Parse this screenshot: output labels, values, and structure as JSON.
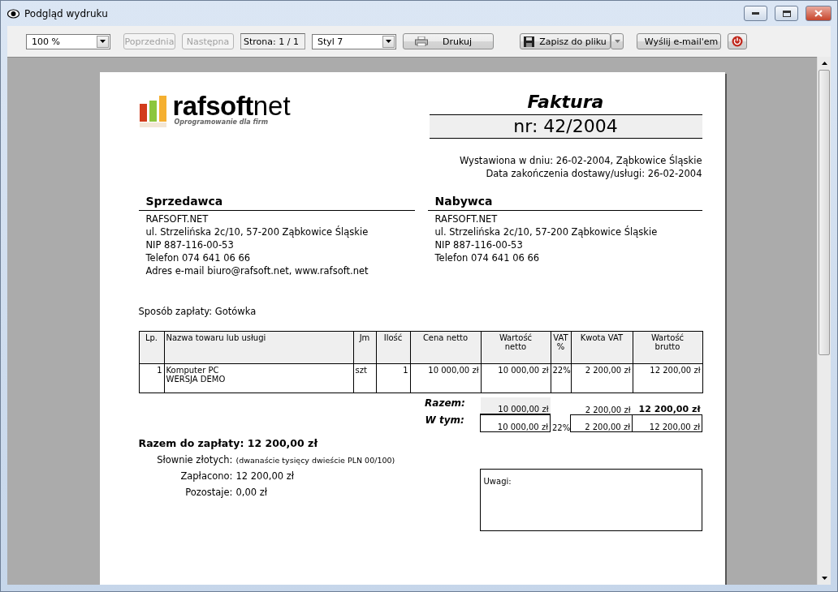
{
  "window": {
    "title": "Podgląd wydruku"
  },
  "toolbar": {
    "zoom": "100 %",
    "nav": [
      {
        "label": "Poprzednia",
        "disabled": true
      },
      {
        "label": "Następna",
        "disabled": true
      }
    ],
    "page_indicator": "Strona: 1 / 1",
    "style": "Styl 7",
    "print": "Drukuj",
    "save": "Zapisz do pliku",
    "email": "Wyślij e-mail'em"
  },
  "invoice": {
    "logo": {
      "brand": "rafsoft",
      "brand_suffix": "net",
      "tagline": "Oprogramowanie dla firm"
    },
    "title": "Faktura",
    "number": "nr: 42/2004",
    "issue_lines": [
      "Wystawiona w dniu: 26-02-2004, Ząbkowice Śląskie",
      "Data zakończenia dostawy/usługi: 26-02-2004"
    ],
    "parties": [
      {
        "heading": "Sprzedawca",
        "lines": [
          "RAFSOFT.NET",
          "ul. Strzelińska 2c/10, 57-200 Ząbkowice Śląskie",
          "NIP 887-116-00-53",
          "Telefon 074 641 06 66",
          "Adres e-mail biuro@rafsoft.net, www.rafsoft.net"
        ]
      },
      {
        "heading": "Nabywca",
        "lines": [
          "RAFSOFT.NET",
          "ul. Strzelińska 2c/10, 57-200 Ząbkowice Śląskie",
          "NIP 887-116-00-53",
          "Telefon 074 641 06 66"
        ]
      }
    ],
    "payment": "Sposób zapłaty: Gotówka",
    "table": {
      "columns": [
        "Lp.",
        "Nazwa towaru lub usługi",
        "Jm",
        "Ilość",
        "Cena netto",
        "Wartość\nnetto",
        "VAT\n%",
        "Kwota VAT",
        "Wartość\nbrutto"
      ],
      "rows": [
        [
          "1",
          "Komputer PC\nWERSJA DEMO",
          "szt",
          "1",
          "10 000,00 zł",
          "10 000,00 zł",
          "22%",
          "2 200,00 zł",
          "12 200,00 zł"
        ]
      ]
    },
    "total": {
      "label": "Razem:",
      "netto": "10 000,00 zł",
      "vat": "2 200,00 zł",
      "brutto": "12 200,00 zł"
    },
    "breakdown": {
      "label": "W tym:",
      "netto": "10 000,00 zł",
      "rate": "22%",
      "vat": "2 200,00 zł",
      "brutto": "12 200,00 zł"
    },
    "amount_due": "Razem do zapłaty: 12 200,00 zł",
    "summary": [
      {
        "label": "Słownie złotych:",
        "value": "(dwanaście tysięcy dwieście PLN 00/100)",
        "kind": "words"
      },
      {
        "label": "Zapłacono:",
        "value": "12 200,00 zł",
        "kind": "amount"
      },
      {
        "label": "Pozostaje:",
        "value": "0,00 zł",
        "kind": "amount"
      }
    ],
    "notes_label": "Uwagi:"
  }
}
